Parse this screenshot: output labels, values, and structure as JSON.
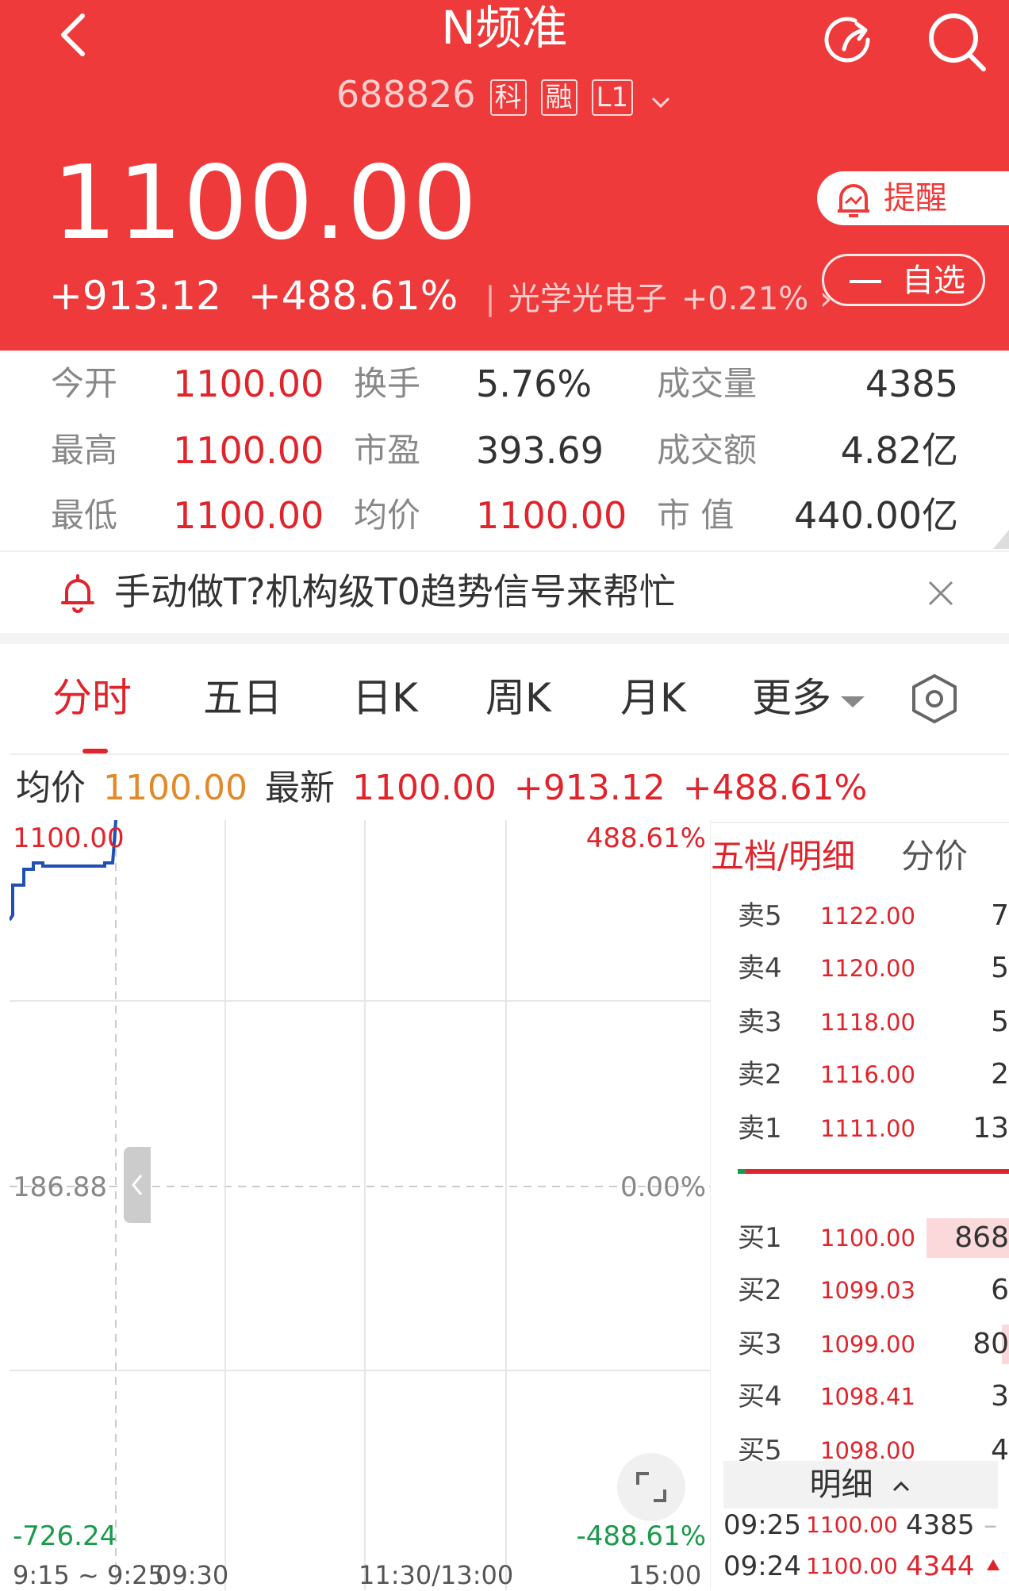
{
  "header": {
    "title": "N频准",
    "code": "688826",
    "tags": [
      "科",
      "融",
      "L1"
    ],
    "price": "1100.00",
    "change": "+913.12",
    "change_pct": "+488.61%",
    "sector_name": "光学光电子",
    "sector_change": "+0.21%",
    "remind_label": "提醒",
    "watch_label": "自选",
    "bg_color": "#ee3a3a"
  },
  "stats": {
    "row1": {
      "l1": "今开",
      "v1": "1100.00",
      "l2": "换手",
      "v2": "5.76%",
      "l3": "成交量",
      "v3": "4385"
    },
    "row2": {
      "l1": "最高",
      "v1": "1100.00",
      "l2": "市盈",
      "v2": "393.69",
      "l3": "成交额",
      "v3": "4.82亿"
    },
    "row3": {
      "l1": "最低",
      "v1": "1100.00",
      "l2": "均价",
      "v2": "1100.00",
      "l3": "市 值",
      "v3": "440.00亿"
    }
  },
  "banner": {
    "text": "手动做T?机构级T0趋势信号来帮忙"
  },
  "tabs": [
    "分时",
    "五日",
    "日K",
    "周K",
    "月K",
    "更多"
  ],
  "info_row": {
    "avg_label": "均价",
    "avg_value": "1100.00",
    "latest_label": "最新",
    "latest_value": "1100.00",
    "change": "+913.12",
    "change_pct": "+488.61%"
  },
  "chart": {
    "y_top_left": "1100.00",
    "y_top_right": "488.61%",
    "y_mid_left": "186.88",
    "y_mid_right": "0.00%",
    "y_bottom_left": "-726.24",
    "y_bottom_right": "-488.61%",
    "x_labels": [
      "9:15 ~ 9:25",
      "09:30",
      "11:30/13:00",
      "15:00"
    ]
  },
  "order_book": {
    "tab_active": "五档/明细",
    "tab_other": "分价",
    "asks": [
      {
        "label": "卖5",
        "price": "1122.00",
        "vol": "7"
      },
      {
        "label": "卖4",
        "price": "1120.00",
        "vol": "5"
      },
      {
        "label": "卖3",
        "price": "1118.00",
        "vol": "5"
      },
      {
        "label": "卖2",
        "price": "1116.00",
        "vol": "2"
      },
      {
        "label": "卖1",
        "price": "1111.00",
        "vol": "13"
      }
    ],
    "bids": [
      {
        "label": "买1",
        "price": "1100.00",
        "vol": "868",
        "bar": 1.0
      },
      {
        "label": "买2",
        "price": "1099.03",
        "vol": "6",
        "bar": 0.0
      },
      {
        "label": "买3",
        "price": "1099.00",
        "vol": "80",
        "bar": 0.09
      },
      {
        "label": "买4",
        "price": "1098.41",
        "vol": "3",
        "bar": 0.0
      },
      {
        "label": "买5",
        "price": "1098.00",
        "vol": "4",
        "bar": 0.0
      }
    ],
    "detail_label": "明细",
    "ticks": [
      {
        "time": "09:25",
        "price": "1100.00",
        "vol": "4385"
      },
      {
        "time": "09:24",
        "price": "1100.00",
        "vol": "4344"
      }
    ]
  }
}
